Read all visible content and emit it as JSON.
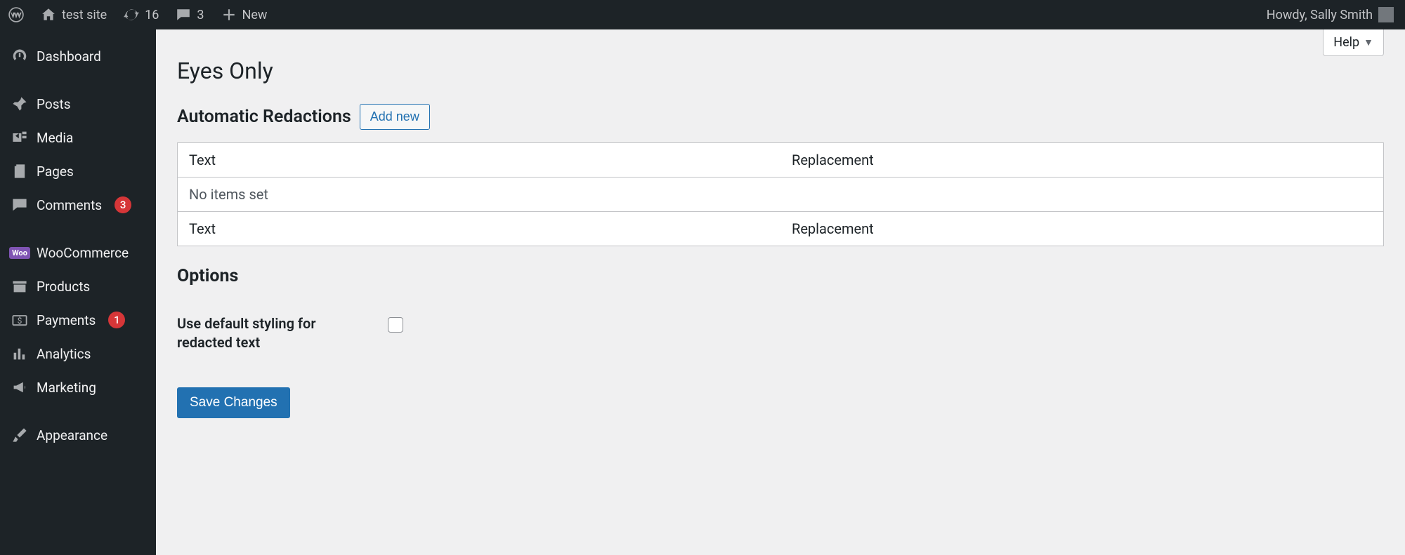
{
  "adminbar": {
    "site_name": "test site",
    "updates_count": "16",
    "comments_count": "3",
    "new_label": "New",
    "greeting": "Howdy, Sally Smith"
  },
  "sidebar": {
    "items": [
      {
        "label": "Dashboard",
        "icon": "dashboard"
      },
      {
        "separator": true
      },
      {
        "label": "Posts",
        "icon": "pin"
      },
      {
        "label": "Media",
        "icon": "media"
      },
      {
        "label": "Pages",
        "icon": "page"
      },
      {
        "label": "Comments",
        "icon": "comment",
        "badge": "3"
      },
      {
        "separator": true
      },
      {
        "label": "WooCommerce",
        "icon": "woo"
      },
      {
        "label": "Products",
        "icon": "archive"
      },
      {
        "label": "Payments",
        "icon": "payments",
        "badge": "1"
      },
      {
        "label": "Analytics",
        "icon": "analytics"
      },
      {
        "label": "Marketing",
        "icon": "megaphone"
      },
      {
        "separator": true
      },
      {
        "label": "Appearance",
        "icon": "brush"
      }
    ]
  },
  "help": {
    "label": "Help"
  },
  "page": {
    "title": "Eyes Only",
    "redactions_heading": "Automatic Redactions",
    "add_new_label": "Add new",
    "table": {
      "col_text": "Text",
      "col_replacement": "Replacement",
      "empty_message": "No items set"
    },
    "options_heading": "Options",
    "option_default_styling_label": "Use default styling for redacted text",
    "save_label": "Save Changes"
  }
}
